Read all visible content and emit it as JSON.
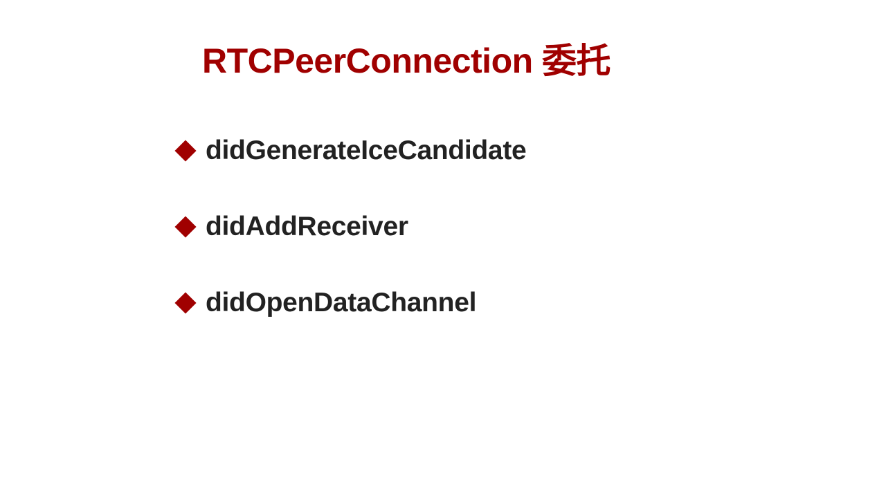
{
  "slide": {
    "title": "RTCPeerConnection 委托",
    "bullets": [
      {
        "icon": "diamond-bullet-icon",
        "text": "didGenerateIceCandidate"
      },
      {
        "icon": "diamond-bullet-icon",
        "text": "didAddReceiver"
      },
      {
        "icon": "diamond-bullet-icon",
        "text": "didOpenDataChannel"
      }
    ]
  },
  "colors": {
    "accent": "#a00000",
    "text": "#222222",
    "background": "#ffffff"
  }
}
